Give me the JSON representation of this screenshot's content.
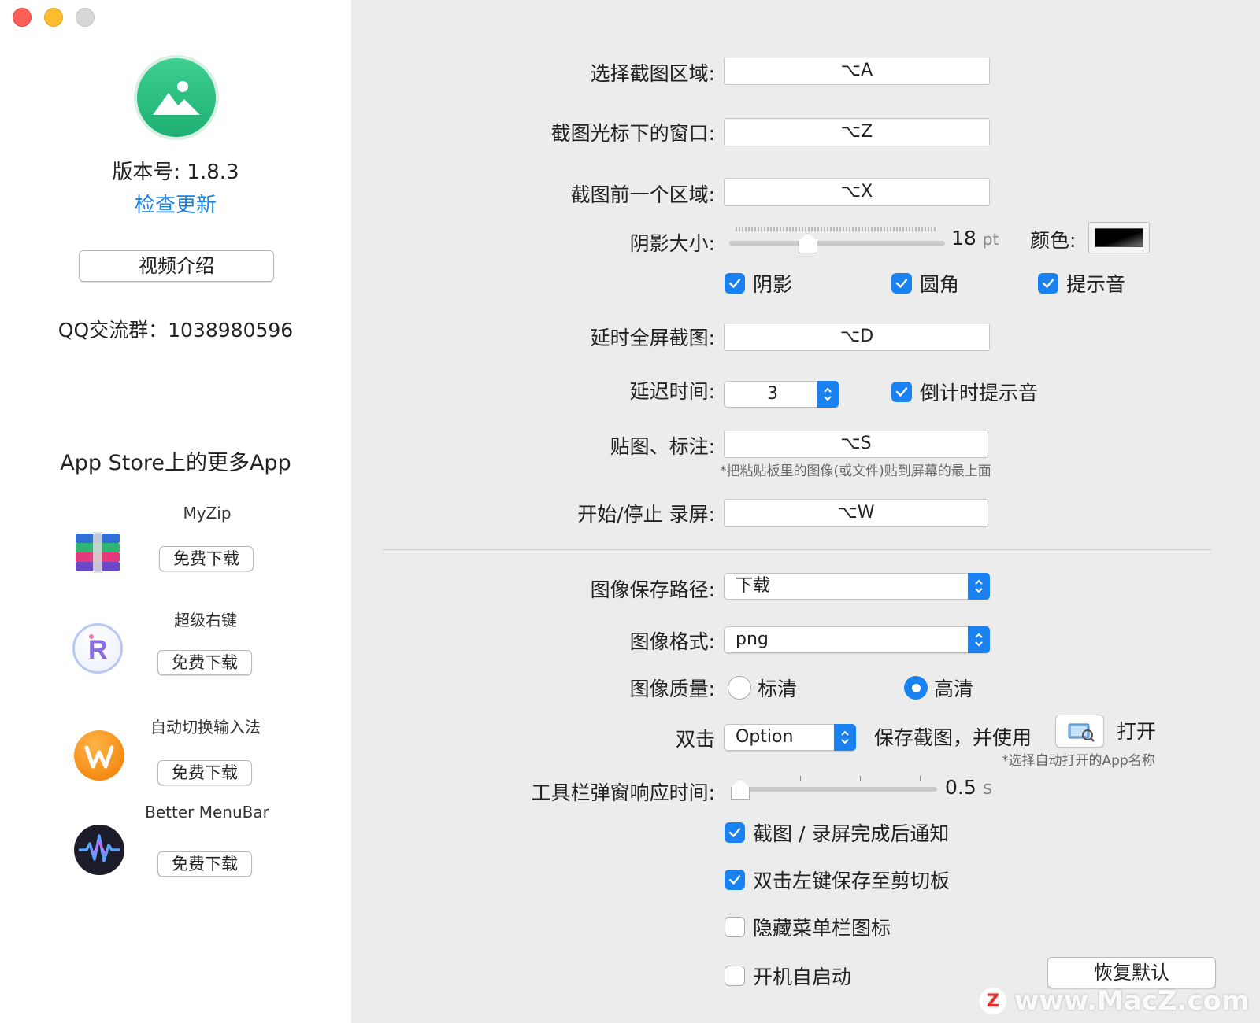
{
  "left": {
    "version_label": "版本号: 1.8.3",
    "check_update": "检查更新",
    "video_button": "视频介绍",
    "qq_group": "QQ交流群：1038980596",
    "store_title": "App Store上的更多App",
    "apps": [
      {
        "name": "MyZip",
        "button": "免费下载",
        "icon": "myzip-icon"
      },
      {
        "name": "超级右键",
        "button": "免费下载",
        "icon": "super-right-click-icon"
      },
      {
        "name": "自动切换输入法",
        "button": "免费下载",
        "icon": "input-switch-icon"
      },
      {
        "name": "Better MenuBar",
        "button": "免费下载",
        "icon": "better-menubar-icon"
      }
    ]
  },
  "settings": {
    "select_area": {
      "label": "选择截图区域:",
      "shortcut": "⌥A"
    },
    "window_under_cursor": {
      "label": "截图光标下的窗口:",
      "shortcut": "⌥Z"
    },
    "previous_area": {
      "label": "截图前一个区域:",
      "shortcut": "⌥X"
    },
    "shadow_size": {
      "label": "阴影大小:",
      "value": "18",
      "unit": "pt",
      "level": 0.35
    },
    "color": {
      "label": "颜色:"
    },
    "options": [
      {
        "label": "阴影",
        "checked": true
      },
      {
        "label": "圆角",
        "checked": true
      },
      {
        "label": "提示音",
        "checked": true
      }
    ],
    "delayed_fullscreen": {
      "label": "延时全屏截图:",
      "shortcut": "⌥D"
    },
    "delay_time": {
      "label": "延迟时间:",
      "value": "3"
    },
    "countdown_sound": {
      "label": "倒计时提示音",
      "checked": true
    },
    "pin_annotate": {
      "label": "贴图、标注:",
      "shortcut": "⌥S",
      "note": "*把粘贴板里的图像(或文件)贴到屏幕的最上面"
    },
    "record": {
      "label": "开始/停止 录屏:",
      "shortcut": "⌥W"
    },
    "save_path": {
      "label": "图像保存路径:",
      "value": "下载"
    },
    "image_format": {
      "label": "图像格式:",
      "value": "png"
    },
    "image_quality": {
      "label": "图像质量:",
      "options": [
        {
          "label": "标清",
          "selected": false
        },
        {
          "label": "高清",
          "selected": true
        }
      ]
    },
    "double_click": {
      "label": "双击",
      "modifier": "Option",
      "text": "保存截图，并使用",
      "open_label": "打开",
      "note": "*选择自动打开的App名称"
    },
    "toolbar_delay": {
      "label": "工具栏弹窗响应时间:",
      "value": "0.5",
      "unit": "s",
      "level": 0.0
    },
    "toggles": [
      {
        "label": "截图 / 录屏完成后通知",
        "checked": true
      },
      {
        "label": "双击左键保存至剪切板",
        "checked": true
      },
      {
        "label": "隐藏菜单栏图标",
        "checked": false
      },
      {
        "label": "开机自启动",
        "checked": false
      }
    ],
    "restore_defaults": "恢复默认"
  },
  "watermark": "www.MacZ.com",
  "colors": {
    "accent": "#1a82f0",
    "link": "#1a82e2",
    "app_icon_green": "#2bbf82"
  }
}
